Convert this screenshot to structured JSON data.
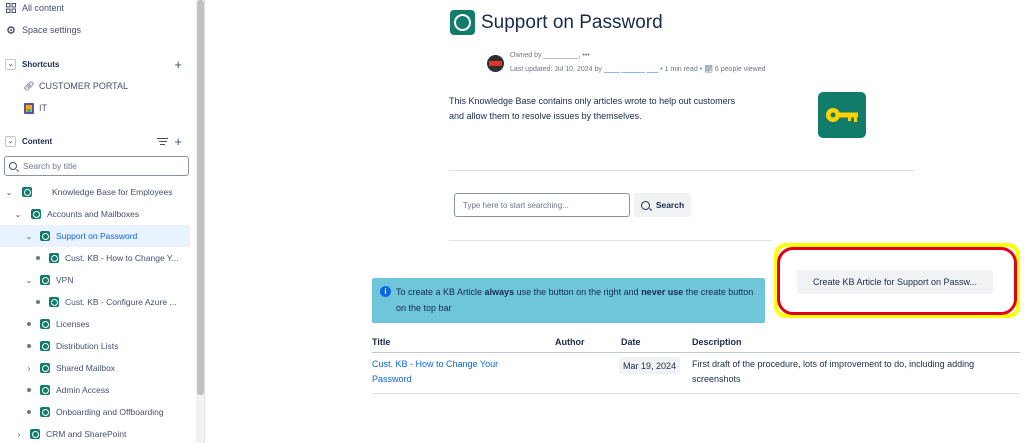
{
  "sidebar": {
    "top_items": [
      {
        "label": "All content",
        "icon": "grid-icon"
      },
      {
        "label": "Space settings",
        "icon": "gear-icon"
      }
    ],
    "shortcuts": {
      "heading": "Shortcuts",
      "items": [
        {
          "label": "CUSTOMER PORTAL",
          "icon": "link-icon"
        },
        {
          "label": "IT",
          "icon": "space-logo-icon"
        }
      ]
    },
    "content": {
      "heading": "Content",
      "search_placeholder": "Search by title",
      "tree": [
        {
          "label": "Knowledge Base for Employees"
        },
        {
          "label": "Accounts and Mailboxes"
        },
        {
          "label": "Support on Password"
        },
        {
          "label": "Cust. KB - How to Change Y..."
        },
        {
          "label": "VPN"
        },
        {
          "label": "Cust. KB - Configure Azure ..."
        },
        {
          "label": "Licenses"
        },
        {
          "label": "Distribution Lists"
        },
        {
          "label": "Shared Mailbox"
        },
        {
          "label": "Admin Access"
        },
        {
          "label": "Onboarding and Offboarding"
        },
        {
          "label": "CRM and SharePoint"
        }
      ]
    }
  },
  "page": {
    "title": "Support on Password",
    "owned_by": "Owned by _________, •••",
    "last_updated_prefix": "Last updated: Jul 10, 2024 by ",
    "last_updated_user": "____ ______ ___",
    "read_time": "• 1 min read •",
    "views": "6 people viewed",
    "intro": "This Knowledge Base contains only articles wrote to help out customers and allow them to resolve issues by themselves.",
    "search_placeholder": "Type here to start searching...",
    "search_button": "Search",
    "info": {
      "t1": "To create a KB Article ",
      "b1": "always",
      "t2": " use the button on the right and ",
      "b2": "never use",
      "t3": " the create button on the top bar"
    },
    "create_button": "Create KB Article for Support on Passw...",
    "table": {
      "headers": [
        "Title",
        "Author",
        "Date",
        "Description"
      ],
      "rows": [
        {
          "title": "Cust. KB - How to Change Your Password",
          "author": "",
          "date": "Mar 19, 2024",
          "description": "First draft of the procedure, lots of improvement to do, including adding screenshots"
        }
      ]
    }
  },
  "colors": {
    "accent": "#0c66e4",
    "kb_icon": "#127c6b",
    "info_bg": "#6fc5da",
    "highlight_yellow": "#ffff00",
    "highlight_red": "#e1001c"
  }
}
